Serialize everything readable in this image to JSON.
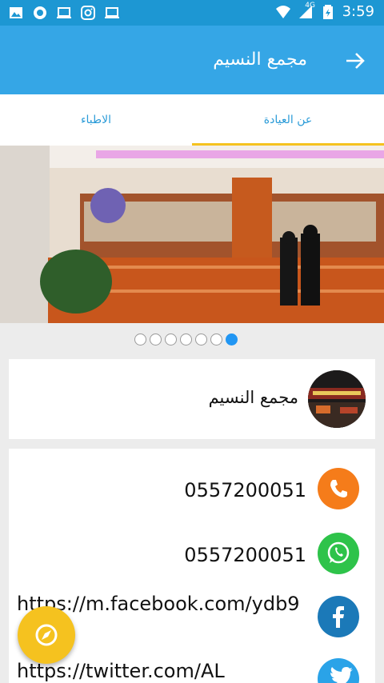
{
  "status_bar": {
    "network": "4G",
    "time": "3:59"
  },
  "app_bar": {
    "title": "مجمع النسيم"
  },
  "tabs": [
    {
      "label": "عن العيادة",
      "selected": true
    },
    {
      "label": "الاطباء",
      "selected": false
    }
  ],
  "carousel": {
    "page_count": 7,
    "active_index": 6
  },
  "clinic": {
    "name": "مجمع النسيم"
  },
  "contacts": {
    "phone": "0557200051",
    "whatsapp": "0557200051",
    "facebook": "https://m.facebook.com/ydb9",
    "twitter": "https://twitter.com/AL"
  },
  "colors": {
    "status_bar": "#1d97d3",
    "app_bar": "#35a6e6",
    "accent": "#f5c21f",
    "phone": "#f57c1a",
    "whatsapp": "#2ec34a",
    "facebook": "#1b79b8",
    "twitter": "#2aa3e8"
  },
  "icons": {
    "back": "arrow-right-icon",
    "fab": "compass-icon"
  }
}
